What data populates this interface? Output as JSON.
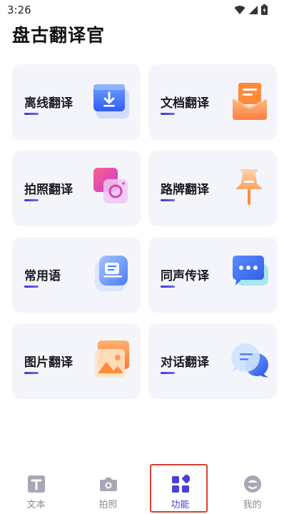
{
  "status": {
    "time": "3:26"
  },
  "app_title": "盘古翻译官",
  "cards": [
    {
      "label": "离线翻译",
      "icon": "download-icon"
    },
    {
      "label": "文档翻译",
      "icon": "document-icon"
    },
    {
      "label": "拍照翻译",
      "icon": "camera-icon"
    },
    {
      "label": "路牌翻译",
      "icon": "signpost-pin-icon"
    },
    {
      "label": "常用语",
      "icon": "phrases-icon"
    },
    {
      "label": "同声传译",
      "icon": "chat-bubble-icon"
    },
    {
      "label": "图片翻译",
      "icon": "image-icon"
    },
    {
      "label": "对话翻译",
      "icon": "dialogue-icon"
    }
  ],
  "nav": {
    "items": [
      {
        "label": "文本",
        "icon": "text-icon"
      },
      {
        "label": "拍照",
        "icon": "camera-icon"
      },
      {
        "label": "功能",
        "icon": "features-icon"
      },
      {
        "label": "我的",
        "icon": "profile-icon"
      }
    ],
    "active": "功能"
  },
  "colors": {
    "accent": "#4a3fd9",
    "highlight": "#d8402f",
    "card_bg": "#f4f5fa"
  }
}
